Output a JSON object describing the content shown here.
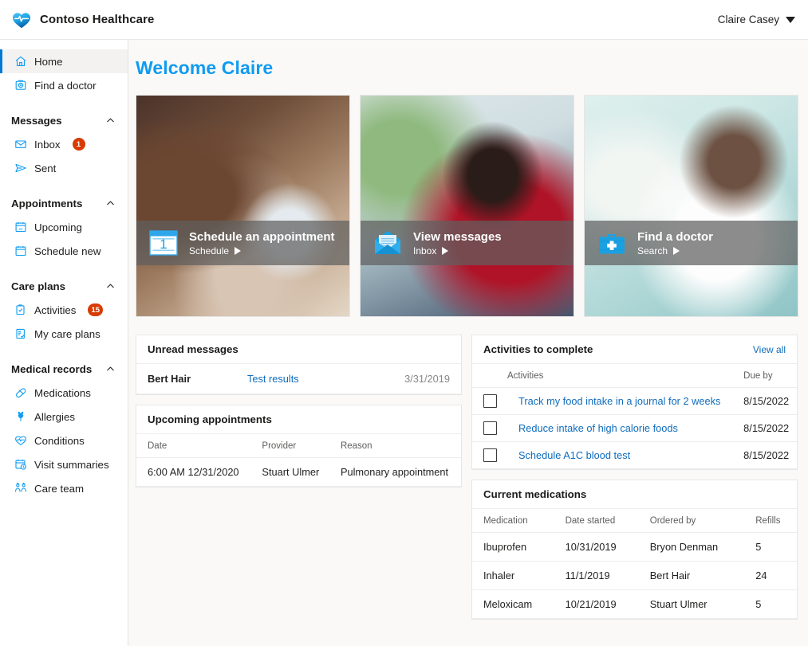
{
  "header": {
    "brand_name": "Contoso Healthcare",
    "logo_icon": "heart-pulse-icon",
    "account_name": "Claire Casey",
    "account_caret_icon": "chevron-down-icon"
  },
  "sidebar": {
    "top_items": [
      {
        "label": "Home",
        "icon": "home-icon",
        "selected": true
      },
      {
        "label": "Find a doctor",
        "icon": "doctor-search-icon",
        "selected": false
      }
    ],
    "groups": [
      {
        "title": "Messages",
        "collapse_icon": "chevron-up-icon",
        "items": [
          {
            "label": "Inbox",
            "icon": "envelope-icon",
            "badge": "1"
          },
          {
            "label": "Sent",
            "icon": "send-icon",
            "badge": ""
          }
        ]
      },
      {
        "title": "Appointments",
        "collapse_icon": "chevron-up-icon",
        "items": [
          {
            "label": "Upcoming",
            "icon": "calendar-day-icon",
            "badge": ""
          },
          {
            "label": "Schedule new",
            "icon": "calendar-icon",
            "badge": ""
          }
        ]
      },
      {
        "title": "Care plans",
        "collapse_icon": "chevron-up-icon",
        "items": [
          {
            "label": "Activities",
            "icon": "clipboard-check-icon",
            "badge": "15"
          },
          {
            "label": "My care plans",
            "icon": "document-check-icon",
            "badge": ""
          }
        ]
      },
      {
        "title": "Medical records",
        "collapse_icon": "chevron-up-icon",
        "items": [
          {
            "label": "Medications",
            "icon": "pill-icon",
            "badge": ""
          },
          {
            "label": "Allergies",
            "icon": "pollen-icon",
            "badge": ""
          },
          {
            "label": "Conditions",
            "icon": "heart-pulse-outline-icon",
            "badge": ""
          },
          {
            "label": "Visit summaries",
            "icon": "calendar-clock-icon",
            "badge": ""
          },
          {
            "label": "Care team",
            "icon": "people-icon",
            "badge": ""
          }
        ]
      }
    ]
  },
  "main": {
    "page_title": "Welcome Claire",
    "hero_cards": [
      {
        "title": "Schedule an appointment",
        "action": "Schedule",
        "icon": "calendar-number-icon",
        "arrow_icon": "play-arrow-icon"
      },
      {
        "title": "View messages",
        "action": "Inbox",
        "icon": "open-envelope-icon",
        "arrow_icon": "play-arrow-icon"
      },
      {
        "title": "Find a doctor",
        "action": "Search",
        "icon": "medical-bag-icon",
        "arrow_icon": "play-arrow-icon"
      }
    ],
    "unread_messages": {
      "title": "Unread messages",
      "rows": [
        {
          "sender": "Bert Hair",
          "subject": "Test results",
          "date": "3/31/2019"
        }
      ]
    },
    "upcoming_appointments": {
      "title": "Upcoming appointments",
      "columns": [
        "Date",
        "Provider",
        "Reason"
      ],
      "rows": [
        {
          "date": "6:00 AM 12/31/2020",
          "provider": "Stuart Ulmer",
          "reason": "Pulmonary appointment"
        }
      ]
    },
    "activities": {
      "title": "Activities to complete",
      "view_all_label": "View all",
      "columns": [
        "Activities",
        "Due by"
      ],
      "rows": [
        {
          "name": "Track my food intake in a journal for 2 weeks",
          "due": "8/15/2022",
          "checked": false
        },
        {
          "name": "Reduce intake of high calorie foods",
          "due": "8/15/2022",
          "checked": false
        },
        {
          "name": "Schedule A1C blood test",
          "due": "8/15/2022",
          "checked": false
        }
      ]
    },
    "medications": {
      "title": "Current medications",
      "columns": [
        "Medication",
        "Date started",
        "Ordered by",
        "Refills"
      ],
      "rows": [
        {
          "medication": "Ibuprofen",
          "date_started": "10/31/2019",
          "ordered_by": "Bryon Denman",
          "refills": "5"
        },
        {
          "medication": "Inhaler",
          "date_started": "11/1/2019",
          "ordered_by": "Bert Hair",
          "refills": "24"
        },
        {
          "medication": "Meloxicam",
          "date_started": "10/21/2019",
          "ordered_by": "Stuart Ulmer",
          "refills": "5"
        }
      ]
    }
  },
  "colors": {
    "accent_blue": "#0078d4",
    "title_blue": "#0f9bf0",
    "link_blue": "#0f6cbd",
    "badge_red": "#d83b01",
    "icon_blue": "#0f9bf0"
  }
}
